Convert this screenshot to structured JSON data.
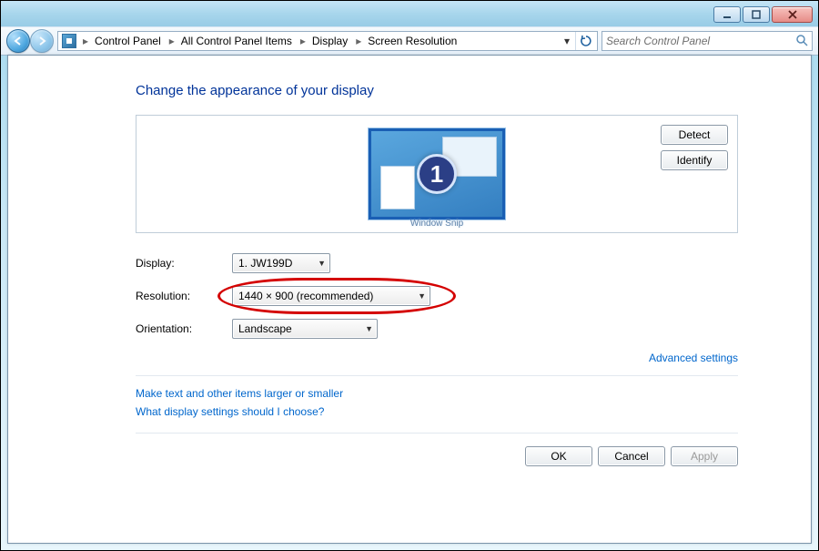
{
  "breadcrumbs": {
    "items": [
      "Control Panel",
      "All Control Panel Items",
      "Display",
      "Screen Resolution"
    ]
  },
  "search": {
    "placeholder": "Search Control Panel"
  },
  "page": {
    "title": "Change the appearance of your display",
    "detect_label": "Detect",
    "identify_label": "Identify",
    "monitor_number": "1",
    "snip_text": "Window Snip"
  },
  "form": {
    "display_label": "Display:",
    "display_value": "1. JW199D",
    "resolution_label": "Resolution:",
    "resolution_value": "1440 × 900 (recommended)",
    "orientation_label": "Orientation:",
    "orientation_value": "Landscape"
  },
  "links": {
    "advanced": "Advanced settings",
    "text_size": "Make text and other items larger or smaller",
    "help": "What display settings should I choose?"
  },
  "footer": {
    "ok": "OK",
    "cancel": "Cancel",
    "apply": "Apply"
  }
}
